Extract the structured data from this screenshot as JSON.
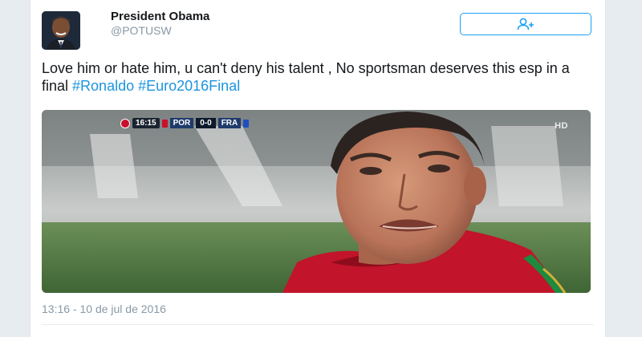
{
  "user": {
    "display_name": "President Obama",
    "handle": "@POTUSW"
  },
  "follow_button": {
    "icon": "follow-user-plus-icon"
  },
  "tweet": {
    "text": "Love him or hate him, u can't deny his talent , No sportsman deserves this esp in a final ",
    "hashtags": [
      "#Ronaldo",
      "#Euro2016Final"
    ],
    "timestamp": "13:16 - 10 de jul de 2016"
  },
  "media": {
    "scorebug": {
      "time": "16:15",
      "home_team": "POR",
      "score": "0-0",
      "away_team": "FRA"
    },
    "broadcaster_logo": "HD"
  },
  "colors": {
    "link": "#1b95e0",
    "follow_border": "#1da1f2",
    "secondary_text": "#8899a6"
  }
}
